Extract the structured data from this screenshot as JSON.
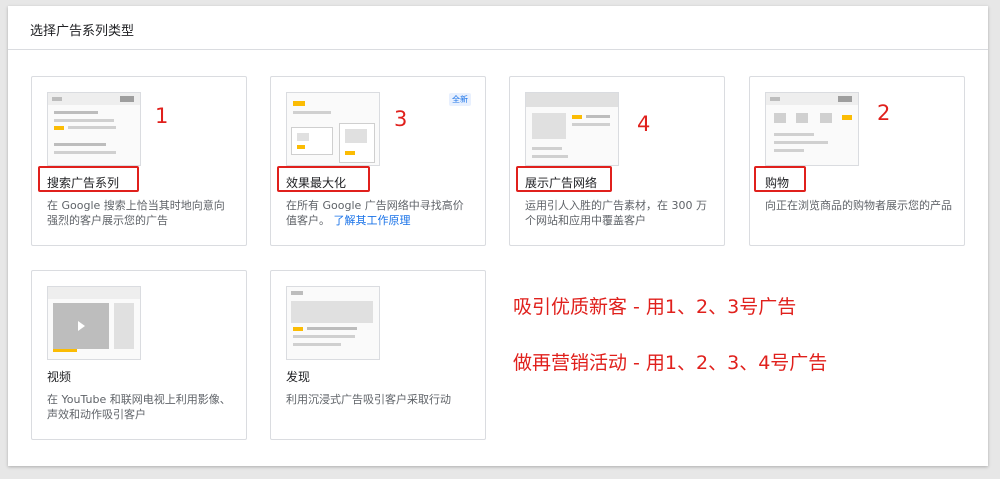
{
  "panel": {
    "title": "选择广告系列类型"
  },
  "cards": [
    {
      "title": "搜索广告系列",
      "desc": "在 Google 搜索上恰当其时地向意向强烈的客户展示您的广告",
      "annotation": "1"
    },
    {
      "title": "效果最大化",
      "desc": "在所有 Google 广告网络中寻找高价值客户。",
      "link": "了解其工作原理",
      "badge": "全新",
      "annotation": "3"
    },
    {
      "title": "展示广告网络",
      "desc": "运用引人入胜的广告素材，在 300 万个网站和应用中覆盖客户",
      "annotation": "4"
    },
    {
      "title": "购物",
      "desc": "向正在浏览商品的购物者展示您的产品",
      "annotation": "2"
    },
    {
      "title": "视频",
      "desc": "在 YouTube 和联网电视上利用影像、声效和动作吸引客户"
    },
    {
      "title": "发现",
      "desc": "利用沉浸式广告吸引客户采取行动"
    }
  ],
  "notes": {
    "line1": "吸引优质新客 - 用1、2、3号广告",
    "line2": "做再营销活动 - 用1、2、3、4号广告"
  },
  "colors": {
    "annotation_red": "#e0201c",
    "accent_yellow": "#fbbc04",
    "link_blue": "#1a73e8"
  }
}
